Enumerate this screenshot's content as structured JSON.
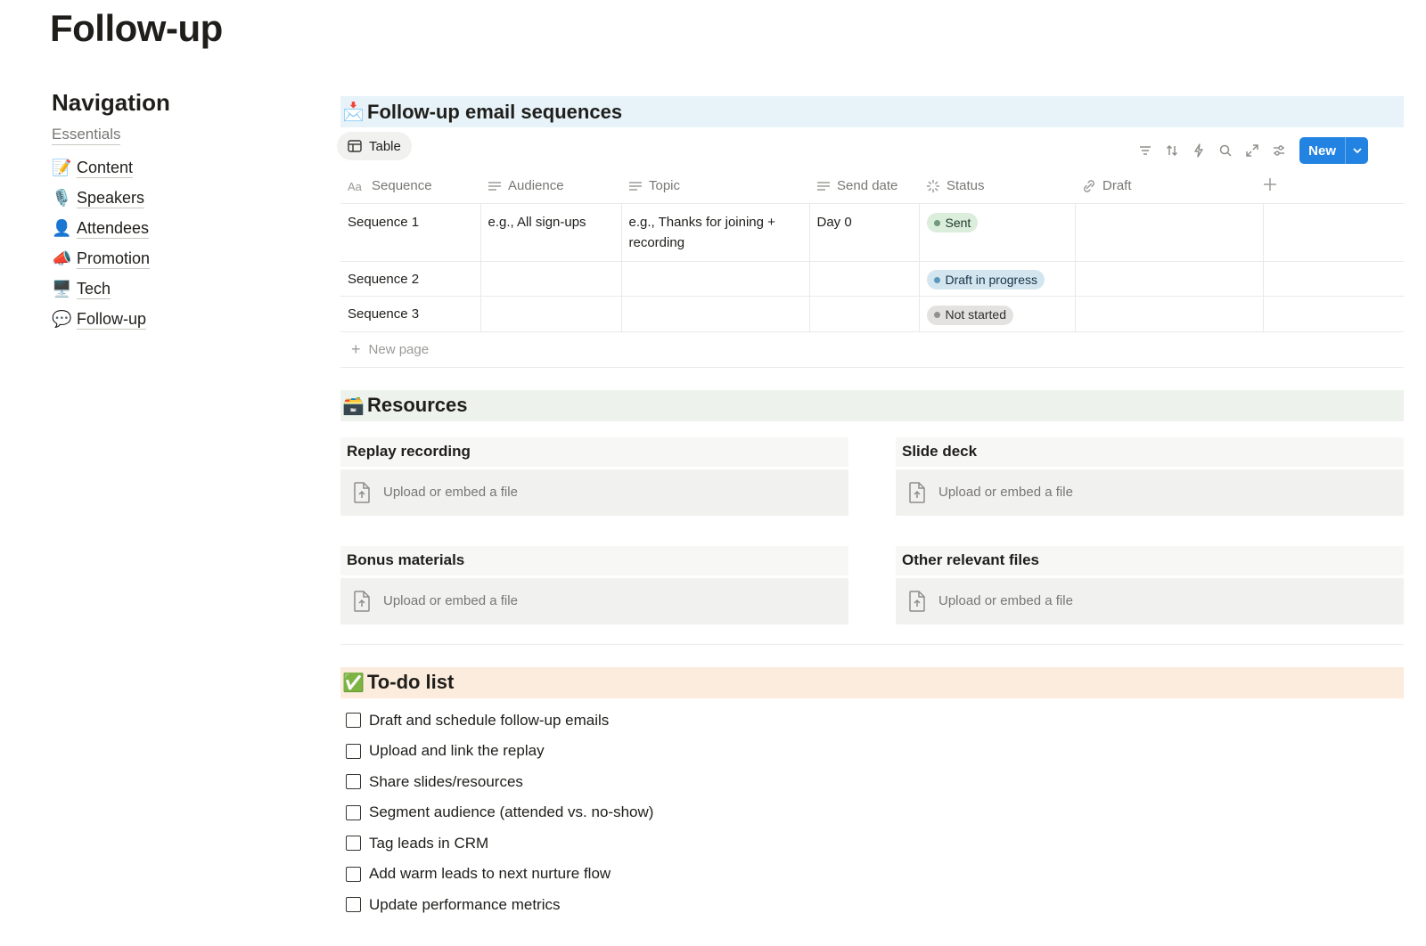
{
  "page": {
    "title": "Follow-up"
  },
  "nav": {
    "title": "Navigation",
    "subtitle": "Essentials",
    "items": [
      {
        "emoji": "📝",
        "label": "Content"
      },
      {
        "emoji": "🎙️",
        "label": "Speakers"
      },
      {
        "emoji": "👤",
        "label": "Attendees"
      },
      {
        "emoji": "📣",
        "label": "Promotion"
      },
      {
        "emoji": "🖥️",
        "label": "Tech"
      },
      {
        "emoji": "💬",
        "label": "Follow-up"
      }
    ]
  },
  "sequences": {
    "emoji": "📩",
    "title": "Follow-up email sequences",
    "view_tab": "Table",
    "new_button": "New",
    "columns": {
      "sequence": "Sequence",
      "audience": "Audience",
      "topic": "Topic",
      "send_date": "Send date",
      "status": "Status",
      "draft": "Draft"
    },
    "rows": [
      {
        "sequence": "Sequence 1",
        "audience": "e.g., All sign-ups",
        "topic": "e.g., Thanks for joining + recording",
        "send_date": "Day 0",
        "status": "Sent",
        "draft": ""
      },
      {
        "sequence": "Sequence 2",
        "audience": "",
        "topic": "",
        "send_date": "",
        "status": "Draft in progress",
        "draft": ""
      },
      {
        "sequence": "Sequence 3",
        "audience": "",
        "topic": "",
        "send_date": "",
        "status": "Not started",
        "draft": ""
      }
    ],
    "new_page": "New page",
    "status_colors": {
      "sent_bg": "#dbeddb",
      "sent_dot": "#6c9b7d",
      "progress_bg": "#d3e5ef",
      "progress_dot": "#5b97bd",
      "notstarted_bg": "#e3e2e0",
      "notstarted_dot": "#91918e"
    }
  },
  "resources": {
    "emoji": "🗃️",
    "title": "Resources",
    "cards": [
      {
        "label": "Replay recording",
        "upload": "Upload or embed a file"
      },
      {
        "label": "Slide deck",
        "upload": "Upload or embed a file"
      },
      {
        "label": "Bonus materials",
        "upload": "Upload or embed a file"
      },
      {
        "label": "Other relevant files",
        "upload": "Upload or embed a file"
      }
    ]
  },
  "todo": {
    "emoji": "✅",
    "title": "To-do list",
    "items": [
      "Draft and schedule follow-up emails",
      "Upload and link the replay",
      "Share slides/resources",
      "Segment audience (attended vs. no-show)",
      "Tag leads in CRM",
      "Add warm leads to next nurture flow",
      "Update performance metrics"
    ]
  },
  "colors": {
    "accent": "#2383e2"
  }
}
